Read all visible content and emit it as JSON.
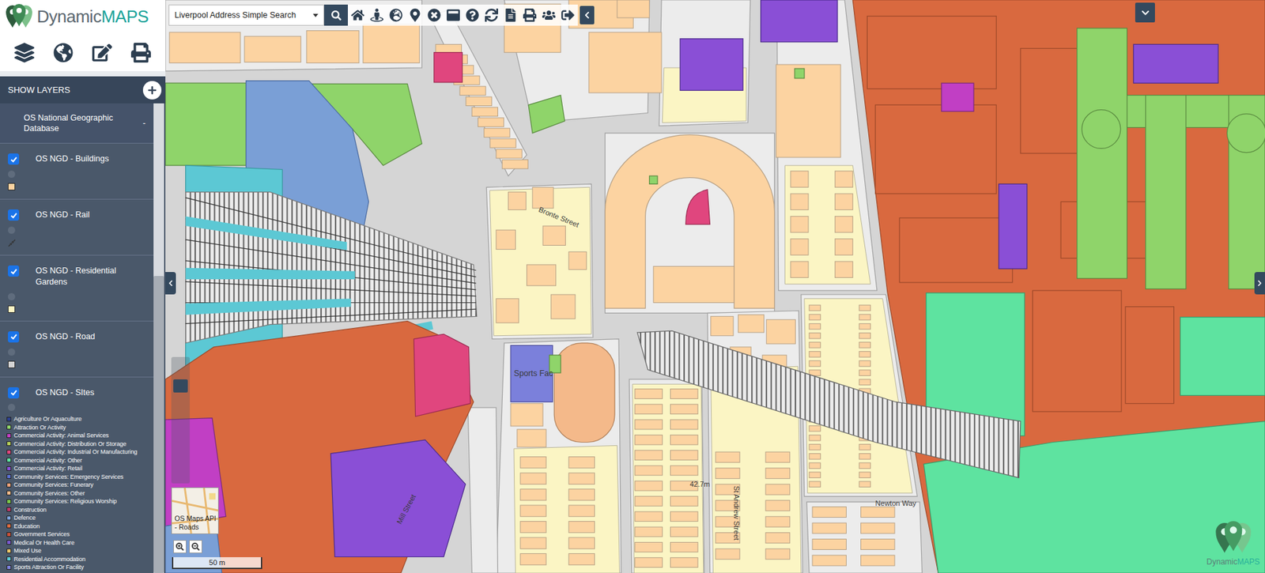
{
  "app": {
    "logo": {
      "word": "Dynamic",
      "accent": "MAPS"
    }
  },
  "search": {
    "value": "Liverpool Address Simple Search"
  },
  "sidebar": {
    "title": "SHOW LAYERS",
    "group": {
      "label": "OS National Geographic Database",
      "toggle": "-",
      "expanded": true
    },
    "layers": [
      {
        "label": "OS NGD - Buildings",
        "checked": true,
        "kind": "fill",
        "color": "#fcd3a1"
      },
      {
        "label": "OS NGD - Rail",
        "checked": true,
        "kind": "line",
        "color": "#333333"
      },
      {
        "label": "OS NGD - Residential Gardens",
        "checked": true,
        "kind": "fill",
        "color": "#fbf5c4"
      },
      {
        "label": "OS NGD - Road",
        "checked": true,
        "kind": "fill",
        "color": "#d5d5d5"
      },
      {
        "label": "OS NGD - SItes",
        "checked": true,
        "kind": "legend",
        "color": "#ffffff"
      }
    ],
    "legend": [
      {
        "label": "Agriculture Or Aquaculture",
        "color": "#2b3f8f"
      },
      {
        "label": "Attraction Or Activity",
        "color": "#8fd46a"
      },
      {
        "label": "Commercial Activity: Animal Services",
        "color": "#c13fc4"
      },
      {
        "label": "Commercial Activity: Distribution Or Storage",
        "color": "#b5cf5a"
      },
      {
        "label": "Commercial Activity: Industrial Or Manufacturing",
        "color": "#e0467e"
      },
      {
        "label": "Commercial Activity: Other",
        "color": "#5ee3a0"
      },
      {
        "label": "Commercial Activity: Retail",
        "color": "#8a4fd6"
      },
      {
        "label": "Community Services: Emergency Services",
        "color": "#5a6fd0"
      },
      {
        "label": "Community Services: Funerary",
        "color": "#e8a07a"
      },
      {
        "label": "Community Services: Other",
        "color": "#f4b98a"
      },
      {
        "label": "Community Services: Religious Worship",
        "color": "#7cc84a"
      },
      {
        "label": "Construction",
        "color": "#c0396b"
      },
      {
        "label": "Defence",
        "color": "#7a9fd6"
      },
      {
        "label": "Education",
        "color": "#d9693f"
      },
      {
        "label": "Government Services",
        "color": "#c8503a"
      },
      {
        "label": "Medical Or Health Care",
        "color": "#7a5ad0"
      },
      {
        "label": "Mixed Use",
        "color": "#e8c46a"
      },
      {
        "label": "Residential Accommodation",
        "color": "#5cc8d4"
      },
      {
        "label": "Sports Attraction Or Facility",
        "color": "#7b80db"
      }
    ]
  },
  "map": {
    "labels": [
      {
        "text": "Bronte Street"
      },
      {
        "text": "Sports Fac"
      },
      {
        "text": "42.7m"
      },
      {
        "text": "St Andrew Street"
      },
      {
        "text": "Newton Way"
      },
      {
        "text": "Mill Street"
      }
    ],
    "zoom": {
      "level": 0.8
    },
    "basemap": {
      "label": "OS Maps API - Roads"
    },
    "scale": "50 m"
  }
}
